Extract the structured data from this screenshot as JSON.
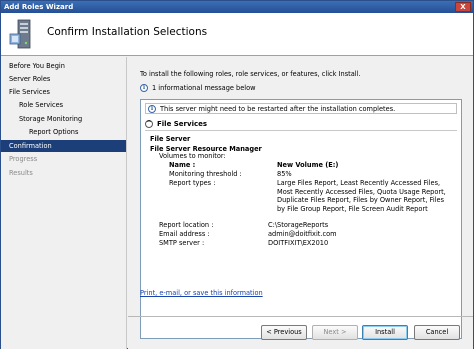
{
  "window": {
    "title": "Add Roles Wizard",
    "close_glyph": "X"
  },
  "header": {
    "title": "Confirm Installation Selections"
  },
  "nav": {
    "items": [
      {
        "label": "Before You Begin",
        "level": 0,
        "state": "normal"
      },
      {
        "label": "Server Roles",
        "level": 0,
        "state": "normal"
      },
      {
        "label": "File Services",
        "level": 0,
        "state": "normal"
      },
      {
        "label": "Role Services",
        "level": 1,
        "state": "normal"
      },
      {
        "label": "Storage Monitoring",
        "level": 1,
        "state": "normal"
      },
      {
        "label": "Report Options",
        "level": 2,
        "state": "normal"
      },
      {
        "label": "Confirmation",
        "level": 0,
        "state": "active"
      },
      {
        "label": "Progress",
        "level": 0,
        "state": "disabled"
      },
      {
        "label": "Results",
        "level": 0,
        "state": "disabled"
      }
    ]
  },
  "content": {
    "intro": "To install the following roles, role services, or features, click Install.",
    "info_count": "1 informational message below",
    "notice": "This server might need to be restarted after the installation completes.",
    "section_title": "File Services",
    "role": "File Server",
    "subrole": "File Server Resource Manager",
    "volumes_label": "Volumes to monitor:",
    "name_label": "Name :",
    "name_value": "New Volume (E:)",
    "threshold_label": "Monitoring threshold :",
    "threshold_value": "85%",
    "report_types_label": "Report types :",
    "report_types_value": "Large Files Report, Least Recently Accessed Files, Most Recently Accessed Files, Quota Usage Report, Duplicate Files Report, Files by Owner Report, Files by File Group Report, File Screen Audit Report",
    "report_location_label": "Report location :",
    "report_location_value": "C:\\StorageReports",
    "email_label": "Email address :",
    "email_value": "admin@doitfixit.com",
    "smtp_label": "SMTP server :",
    "smtp_value": "DOITFIXIT\\EX2010",
    "print_link": "Print, e-mail, or save this information"
  },
  "buttons": {
    "previous": "< Previous",
    "next": "Next >",
    "install": "Install",
    "cancel": "Cancel"
  },
  "colors": {
    "accent": "#1c3f7a",
    "link": "#1a44b0"
  }
}
